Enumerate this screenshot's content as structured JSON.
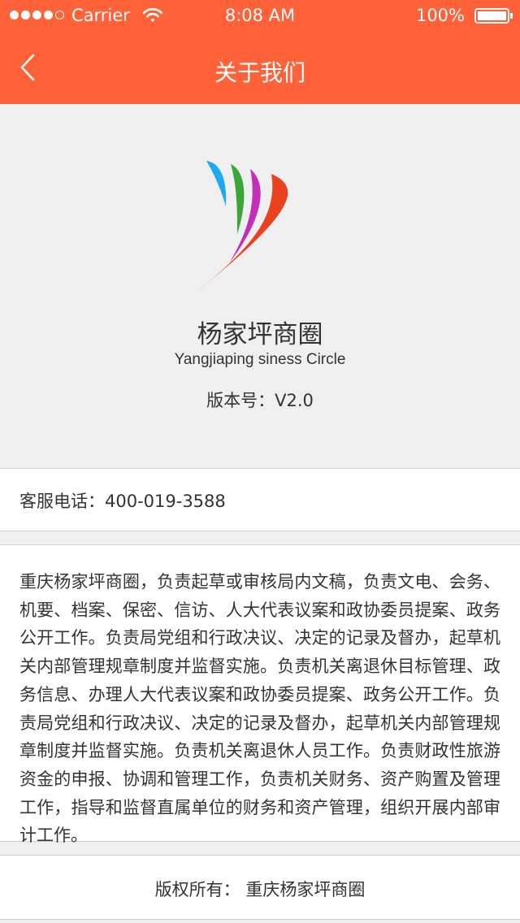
{
  "status_bar": {
    "carrier": "Carrier",
    "time": "8:08 AM",
    "battery": "100%"
  },
  "nav": {
    "title": "关于我们"
  },
  "about": {
    "name": "杨家坪商圈",
    "subname": "Yangjiaping siness Circle",
    "version": "版本号：V2.0"
  },
  "contact": {
    "phone": "客服电话：400-019-3588"
  },
  "description": "重庆杨家坪商圈，负责起草或审核局内文稿，负责文电、会务、机要、档案、保密、信访、人大代表议案和政协委员提案、政务公开工作。负责局党组和行政决议、决定的记录及督办，起草机关内部管理规章制度并监督实施。负责机关离退休目标管理、政务信息、办理人大代表议案和政协委员提案、政务公开工作。负责局党组和行政决议、决定的记录及督办，起草机关内部管理规章制度并监督实施。负责机关离退休人员工作。负责财政性旅游资金的申报、协调和管理工作，负责机关财务、资产购置及管理工作，指导和监督直属单位的财务和资产管理，组织开展内部审计工作。",
  "footer": {
    "copyright": "版权所有：  重庆杨家坪商圈"
  },
  "colors": {
    "nav_bar": "#ff6138",
    "page_bg": "#efefef",
    "logo_stripes": [
      "#1ea8f0",
      "#3aa63a",
      "#c42fb7",
      "#e8421f"
    ]
  },
  "icons": {
    "back": "chevron-left-icon",
    "wifi": "wifi-icon",
    "battery": "battery-icon",
    "signal": "signal-dots-icon",
    "logo": "app-logo"
  }
}
